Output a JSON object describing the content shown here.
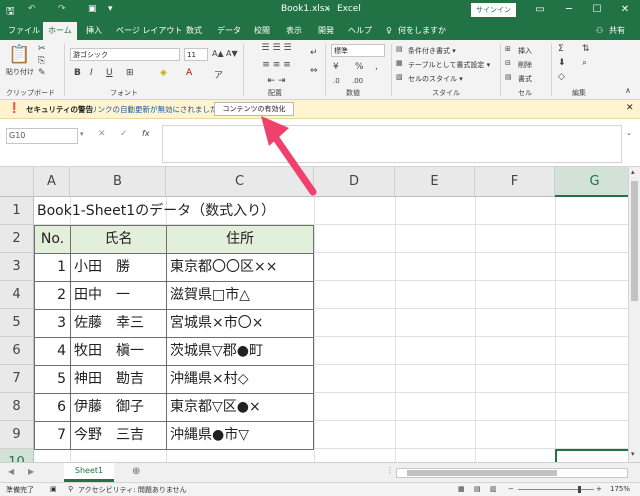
{
  "titlebar": {
    "filename": "Book1.xlsx",
    "dash": "-",
    "app": "Excel",
    "signin": "サインイン"
  },
  "tabs": [
    "ファイル",
    "ホーム",
    "挿入",
    "ページ レイアウト",
    "数式",
    "データ",
    "校閲",
    "表示",
    "開発",
    "ヘルプ",
    "何をしますか"
  ],
  "share": "共有",
  "ribbon": {
    "paste": "貼り付け",
    "clipboard": "クリップボード",
    "font_name": "游ゴシック",
    "font_size": "11",
    "font_group": "フォント",
    "align_group": "配置",
    "number_format": "標準",
    "number_group": "数値",
    "cond_format": "条件付き書式 ▾",
    "table_format": "テーブルとして書式設定 ▾",
    "cell_style": "セルのスタイル ▾",
    "style_group": "スタイル",
    "insert": "挿入",
    "delete": "削除",
    "format": "書式",
    "cells_group": "セル",
    "edit_group": "編集"
  },
  "security": {
    "title": "セキュリティの警告",
    "message": "リンクの自動更新が無効にされました",
    "button": "コンテンツの有効化"
  },
  "formula": {
    "namebox": "G10",
    "fx": "fx",
    "value": ""
  },
  "columns": [
    "A",
    "B",
    "C",
    "D",
    "E",
    "F",
    "G"
  ],
  "rows": [
    "1",
    "2",
    "3",
    "4",
    "5",
    "6",
    "7",
    "8",
    "9",
    "10"
  ],
  "sheet": {
    "title": "Book1-Sheet1のデータ（数式入り）",
    "headers": [
      "No.",
      "氏名",
      "住所"
    ],
    "records": [
      {
        "no": "1",
        "name": "小田　勝",
        "addr": "東京都〇〇区××"
      },
      {
        "no": "2",
        "name": "田中　一",
        "addr": "滋賀県□市△"
      },
      {
        "no": "3",
        "name": "佐藤　幸三",
        "addr": "宮城県×市〇×"
      },
      {
        "no": "4",
        "name": "牧田　槇一",
        "addr": "茨城県▽郡●町"
      },
      {
        "no": "5",
        "name": "神田　勘吉",
        "addr": "沖縄県×村◇"
      },
      {
        "no": "6",
        "name": "伊藤　御子",
        "addr": "東京都▽区●×"
      },
      {
        "no": "7",
        "name": "今野　三吉",
        "addr": "沖縄県●市▽"
      }
    ]
  },
  "sheet_tab": "Sheet1",
  "status": {
    "ready": "準備完了",
    "accessibility": "アクセシビリティ: 問題ありません",
    "zoom": "175%"
  },
  "colors": {
    "excel_green": "#217346",
    "header_fill": "#e2efda",
    "warning_fill": "#fff4ce",
    "arrow": "#f0406e"
  }
}
